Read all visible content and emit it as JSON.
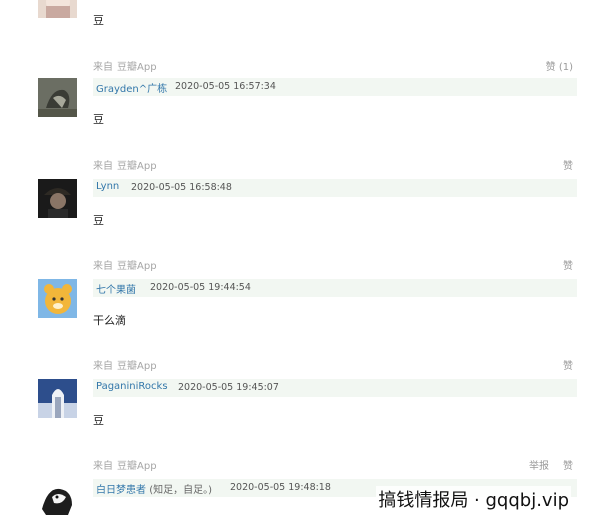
{
  "comments": [
    {
      "source_prefix": "",
      "source_app": "",
      "vote_label": "",
      "report_label": "",
      "username": "",
      "note": "",
      "time": "",
      "text": "豆"
    },
    {
      "source_prefix": "来自",
      "source_app": "豆瓣App",
      "vote_label": "赞 (1)",
      "report_label": "",
      "username": "Grayden^广栋",
      "note": "",
      "time": "2020-05-05 16:57:34",
      "text": "豆"
    },
    {
      "source_prefix": "来自",
      "source_app": "豆瓣App",
      "vote_label": "赞",
      "report_label": "",
      "username": "Lynn",
      "note": "",
      "time": "2020-05-05 16:58:48",
      "text": "豆"
    },
    {
      "source_prefix": "来自",
      "source_app": "豆瓣App",
      "vote_label": "赞",
      "report_label": "",
      "username": "七个果菌",
      "note": "",
      "time": "2020-05-05 19:44:54",
      "text": "干么滴"
    },
    {
      "source_prefix": "来自",
      "source_app": "豆瓣App",
      "vote_label": "赞",
      "report_label": "",
      "username": "PaganiniRocks",
      "note": "",
      "time": "2020-05-05 19:45:07",
      "text": "豆"
    },
    {
      "source_prefix": "来自",
      "source_app": "豆瓣App",
      "vote_label": "赞",
      "report_label": "举报",
      "username": "白日梦患者",
      "note": "(知足，自足。)",
      "time": "2020-05-05 19:48:18",
      "text": ""
    }
  ],
  "watermark": "搞钱情报局 · gqqbj.vip",
  "colors": {
    "username": "#3377aa",
    "meta_bar": "#f2f7f2",
    "muted": "#a6a6a6"
  },
  "icons": [
    "avatar-1",
    "avatar-2",
    "avatar-3",
    "avatar-4",
    "avatar-5",
    "avatar-6"
  ]
}
